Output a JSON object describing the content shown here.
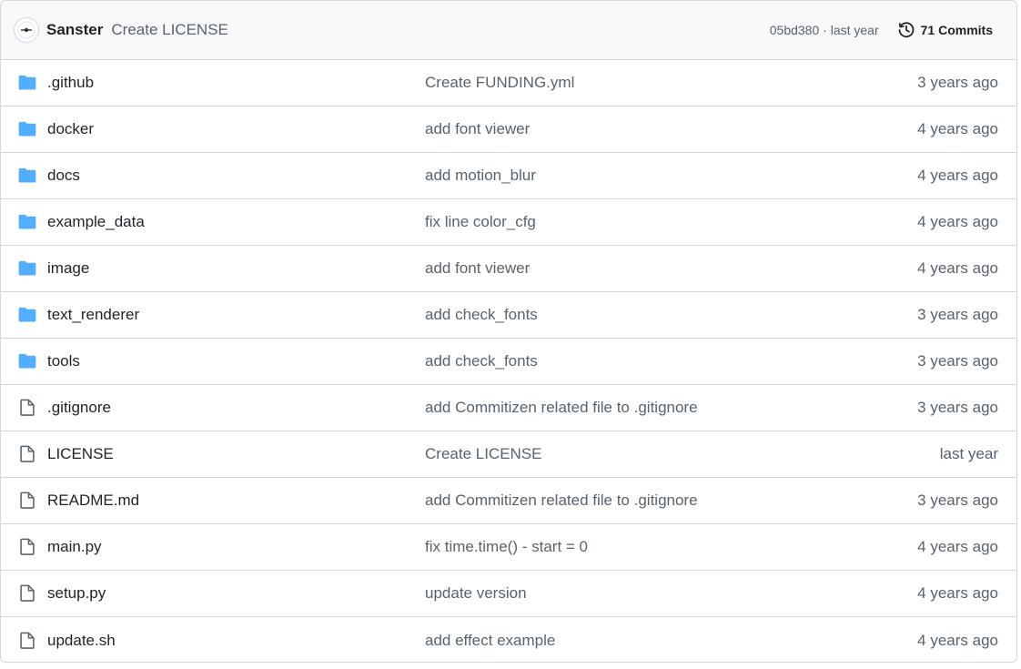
{
  "commit": {
    "author": "Sanster",
    "message": "Create LICENSE",
    "sha": "05bd380",
    "separator": " · ",
    "age": "last year",
    "commits_label": "71 Commits"
  },
  "colors": {
    "folder": "#54aeff",
    "file": "#59636e",
    "muted": "#59636e",
    "border": "#d1d9e0",
    "header_bg": "#f6f8fa"
  },
  "files": [
    {
      "type": "folder",
      "icon": "folder-icon",
      "name": ".github",
      "message": "Create FUNDING.yml",
      "age": "3 years ago"
    },
    {
      "type": "folder",
      "icon": "folder-icon",
      "name": "docker",
      "message": "add font viewer",
      "age": "4 years ago"
    },
    {
      "type": "folder",
      "icon": "folder-icon",
      "name": "docs",
      "message": "add motion_blur",
      "age": "4 years ago"
    },
    {
      "type": "folder",
      "icon": "folder-icon",
      "name": "example_data",
      "message": "fix line color_cfg",
      "age": "4 years ago"
    },
    {
      "type": "folder",
      "icon": "folder-icon",
      "name": "image",
      "message": "add font viewer",
      "age": "4 years ago"
    },
    {
      "type": "folder",
      "icon": "folder-icon",
      "name": "text_renderer",
      "message": "add check_fonts",
      "age": "3 years ago"
    },
    {
      "type": "folder",
      "icon": "folder-icon",
      "name": "tools",
      "message": "add check_fonts",
      "age": "3 years ago"
    },
    {
      "type": "file",
      "icon": "file-icon",
      "name": ".gitignore",
      "message": "add Commitizen related file to .gitignore",
      "age": "3 years ago"
    },
    {
      "type": "file",
      "icon": "file-icon",
      "name": "LICENSE",
      "message": "Create LICENSE",
      "age": "last year"
    },
    {
      "type": "file",
      "icon": "file-icon",
      "name": "README.md",
      "message": "add Commitizen related file to .gitignore",
      "age": "3 years ago"
    },
    {
      "type": "file",
      "icon": "file-icon",
      "name": "main.py",
      "message": "fix time.time() - start = 0",
      "age": "4 years ago"
    },
    {
      "type": "file",
      "icon": "file-icon",
      "name": "setup.py",
      "message": "update version",
      "age": "4 years ago"
    },
    {
      "type": "file",
      "icon": "file-icon",
      "name": "update.sh",
      "message": "add effect example",
      "age": "4 years ago"
    }
  ]
}
